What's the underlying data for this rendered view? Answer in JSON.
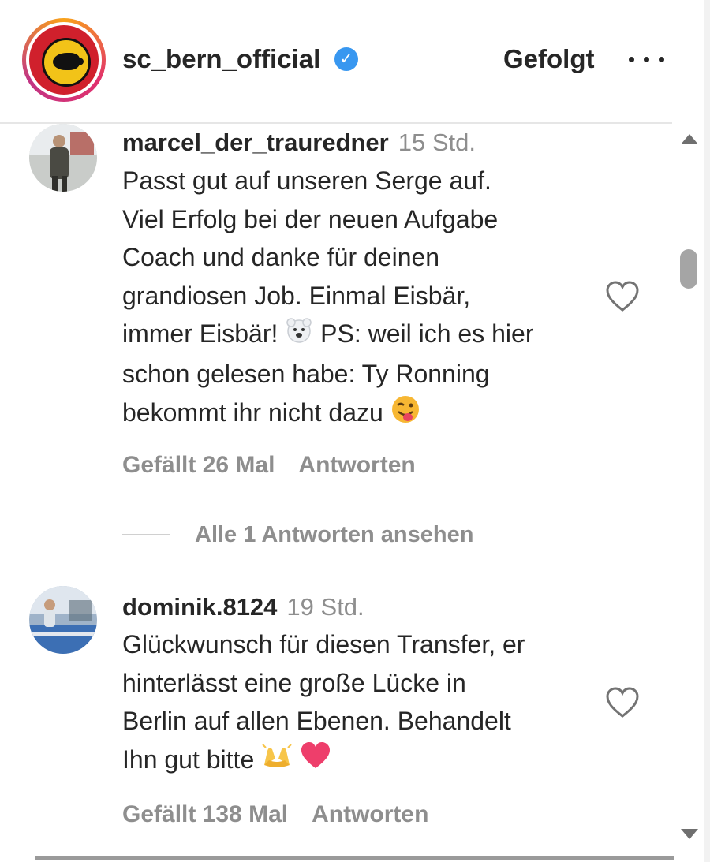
{
  "header": {
    "account_name": "sc_bern_official",
    "verified": true,
    "follow_label": "Gefolgt",
    "more_icon": "more-horizontal-icon"
  },
  "comments": [
    {
      "username": "marcel_der_trauredner",
      "time": "15 Std.",
      "text_lines": [
        "Passt gut auf unseren Serge auf.",
        "Viel Erfolg bei der neuen Aufgabe",
        "Coach und danke für deinen",
        "grandiosen Job. Einmal Eisbär,",
        "immer Eisbär! ",
        " PS: weil ich es hier",
        "schon gelesen habe: Ty Ronning",
        "bekommt ihr nicht dazu "
      ],
      "emojis": [
        "polar-bear-emoji",
        "winking-tongue-emoji"
      ],
      "likes_label": "Gefällt 26 Mal",
      "reply_label": "Antworten",
      "view_replies_label": "Alle 1 Antworten ansehen"
    },
    {
      "username": "dominik.8124",
      "time": "19 Std.",
      "text_lines": [
        "Glückwunsch für diesen Transfer, er",
        "hinterlässt eine große Lücke in",
        "Berlin auf allen Ebenen. Behandelt",
        "Ihn gut bitte "
      ],
      "emojis": [
        "raised-hands-emoji",
        "heart-emoji"
      ],
      "likes_label": "Gefällt 138 Mal",
      "reply_label": "Antworten"
    }
  ],
  "colors": {
    "text": "#262626",
    "secondary": "#8e8e8e",
    "verified": "#3897f0",
    "logo_red": "#d0202c",
    "logo_yellow": "#f2c318"
  }
}
